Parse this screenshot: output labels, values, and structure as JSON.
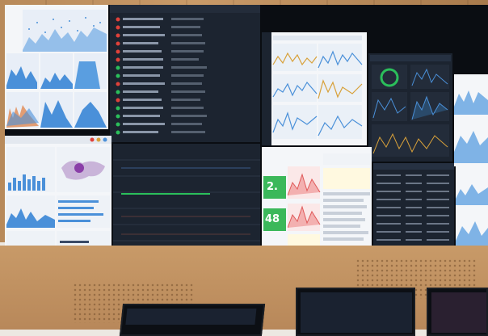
{
  "scene": "control-room-video-wall",
  "colors": {
    "wood": "#c99a68",
    "wall_dark": "#1c2430",
    "green_status": "#2bbf5b",
    "red_status": "#e0413a",
    "chart_blue": "#4a90d9",
    "chart_red": "#e05a5a",
    "accent_green": "#3bb85a"
  },
  "metrics": {
    "left_value": "2.",
    "left_value2": "48"
  }
}
